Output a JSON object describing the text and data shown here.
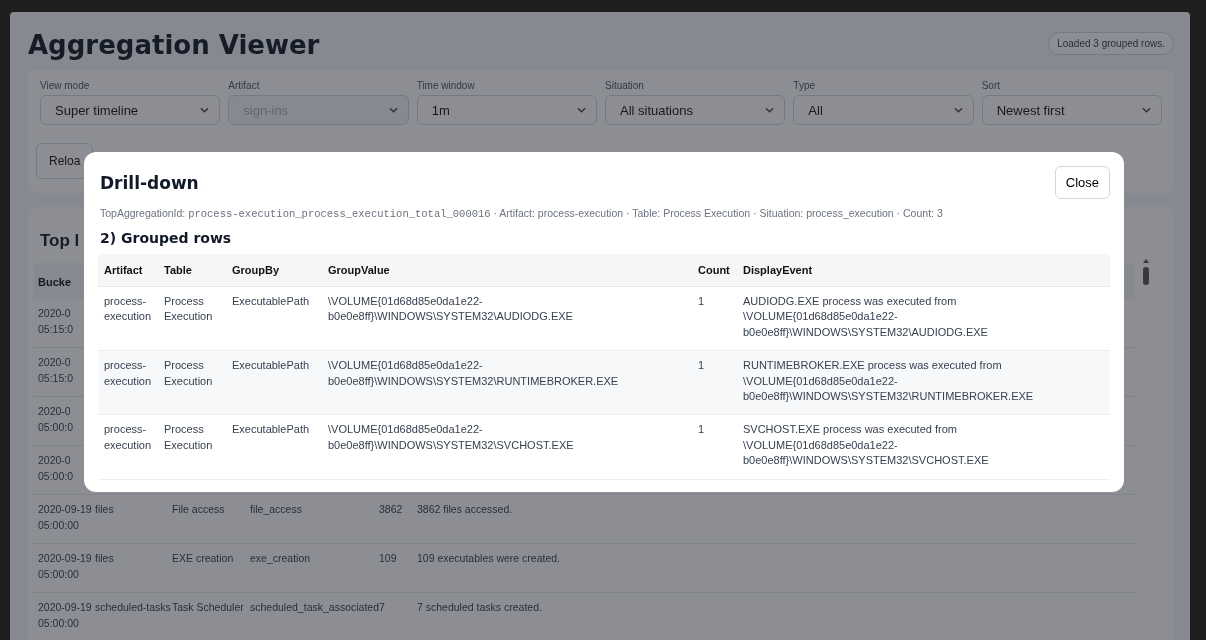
{
  "header": {
    "title": "Aggregation Viewer",
    "status_badge": "Loaded 3 grouped rows."
  },
  "filters": [
    {
      "label": "View mode",
      "value": "Super timeline",
      "disabled": false
    },
    {
      "label": "Artifact",
      "value": "sign-ins",
      "disabled": true
    },
    {
      "label": "Time window",
      "value": "1m",
      "disabled": false
    },
    {
      "label": "Situation",
      "value": "All situations",
      "disabled": false
    },
    {
      "label": "Type",
      "value": "All",
      "disabled": false
    },
    {
      "label": "Sort",
      "value": "Newest first",
      "disabled": false
    }
  ],
  "reload_button": "Reloa",
  "top_section": {
    "title": "Top l",
    "columns": [
      "Bucke"
    ],
    "rows": [
      {
        "date": "2020-0",
        "time": "05:15:0"
      },
      {
        "date": "2020-0",
        "time": "05:15:0"
      },
      {
        "date": "2020-0",
        "time": "05:00:0"
      },
      {
        "date": "2020-0",
        "time": "05:00:0"
      },
      {
        "date": "2020-09-19",
        "time": "05:00:00",
        "artifact": "files",
        "table": "File access",
        "situation": "file_access",
        "count": "3862",
        "display": "3862 files accessed."
      },
      {
        "date": "2020-09-19",
        "time": "05:00:00",
        "artifact": "files",
        "table": "EXE creation",
        "situation": "exe_creation",
        "count": "109",
        "display": "109 executables were created."
      },
      {
        "date": "2020-09-19",
        "time": "05:00:00",
        "artifact": "scheduled-tasks",
        "table": "Task Scheduler",
        "situation": "scheduled_task_associated",
        "count": "7",
        "display": "7 scheduled tasks created."
      }
    ]
  },
  "drilldown": {
    "title": "Drill-down",
    "close_label": "Close",
    "meta": {
      "id_label": "TopAggregationId:",
      "id_value": "process-execution_process_execution_total_000016",
      "details": "· Artifact: process-execution · Table: Process Execution · Situation: process_execution · Count: 3"
    },
    "section_title": "2) Grouped rows",
    "columns": [
      "Artifact",
      "Table",
      "GroupBy",
      "GroupValue",
      "Count",
      "DisplayEvent"
    ],
    "rows": [
      {
        "artifact": "process-execution",
        "table": "Process Execution",
        "group_by": "ExecutablePath",
        "group_value": "\\VOLUME{01d68d85e0da1e22-b0e0e8ff}\\WINDOWS\\SYSTEM32\\AUDIODG.EXE",
        "count": "1",
        "display_event": "AUDIODG.EXE process was executed from \\VOLUME{01d68d85e0da1e22-b0e0e8ff}\\WINDOWS\\SYSTEM32\\AUDIODG.EXE"
      },
      {
        "artifact": "process-execution",
        "table": "Process Execution",
        "group_by": "ExecutablePath",
        "group_value": "\\VOLUME{01d68d85e0da1e22-b0e0e8ff}\\WINDOWS\\SYSTEM32\\RUNTIMEBROKER.EXE",
        "count": "1",
        "display_event": "RUNTIMEBROKER.EXE process was executed from \\VOLUME{01d68d85e0da1e22-b0e0e8ff}\\WINDOWS\\SYSTEM32\\RUNTIMEBROKER.EXE"
      },
      {
        "artifact": "process-execution",
        "table": "Process Execution",
        "group_by": "ExecutablePath",
        "group_value": "\\VOLUME{01d68d85e0da1e22-b0e0e8ff}\\WINDOWS\\SYSTEM32\\SVCHOST.EXE",
        "count": "1",
        "display_event": "SVCHOST.EXE process was executed from \\VOLUME{01d68d85e0da1e22-b0e0e8ff}\\WINDOWS\\SYSTEM32\\SVCHOST.EXE"
      }
    ]
  }
}
